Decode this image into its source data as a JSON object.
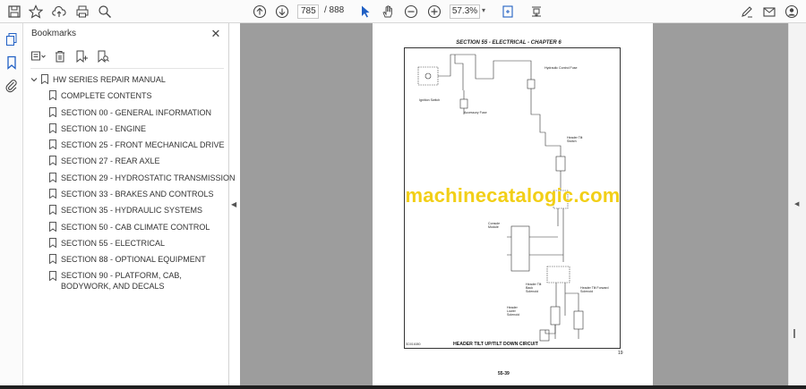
{
  "toolbar": {
    "page_current": "785",
    "page_total": "/ 888",
    "zoom": "57.3%"
  },
  "bookmarks": {
    "title": "Bookmarks",
    "root": "HW SERIES REPAIR MANUAL",
    "items": [
      "COMPLETE CONTENTS",
      "SECTION 00 - GENERAL INFORMATION",
      "SECTION 10 - ENGINE",
      "SECTION 25 - FRONT MECHANICAL DRIVE",
      "SECTION 27 - REAR AXLE",
      "SECTION 29 - HYDROSTATIC TRANSMISSION",
      "SECTION 33 - BRAKES AND CONTROLS",
      "SECTION 35 - HYDRAULIC SYSTEMS",
      "SECTION 50 - CAB CLIMATE CONTROL",
      "SECTION 55 - ELECTRICAL",
      "SECTION 88 - OPTIONAL EQUIPMENT",
      "SECTION 90 - PLATFORM, CAB, BODYWORK, AND DECALS"
    ]
  },
  "document": {
    "header": "SECTION 55 - ELECTRICAL - CHAPTER 6",
    "caption": "HEADER TILT UP/TILT DOWN CIRCUIT",
    "figure_id": "SD016080",
    "figure_number": "19",
    "page_number": "55-39",
    "watermark": "machinecatalogic.com",
    "labels": {
      "ignition": "Ignition Switch",
      "accessory": "Accessory Fuse",
      "hydraulic": "Hydraulic Control Fuse",
      "tilt_switch": "Header Tilt Switch",
      "console": "Console Module",
      "tilt_back": "Header Tilt Back Solenoid",
      "tilt_forward": "Header Tilt Forward Solenoid",
      "lower": "Header Lower Solenoid"
    }
  }
}
